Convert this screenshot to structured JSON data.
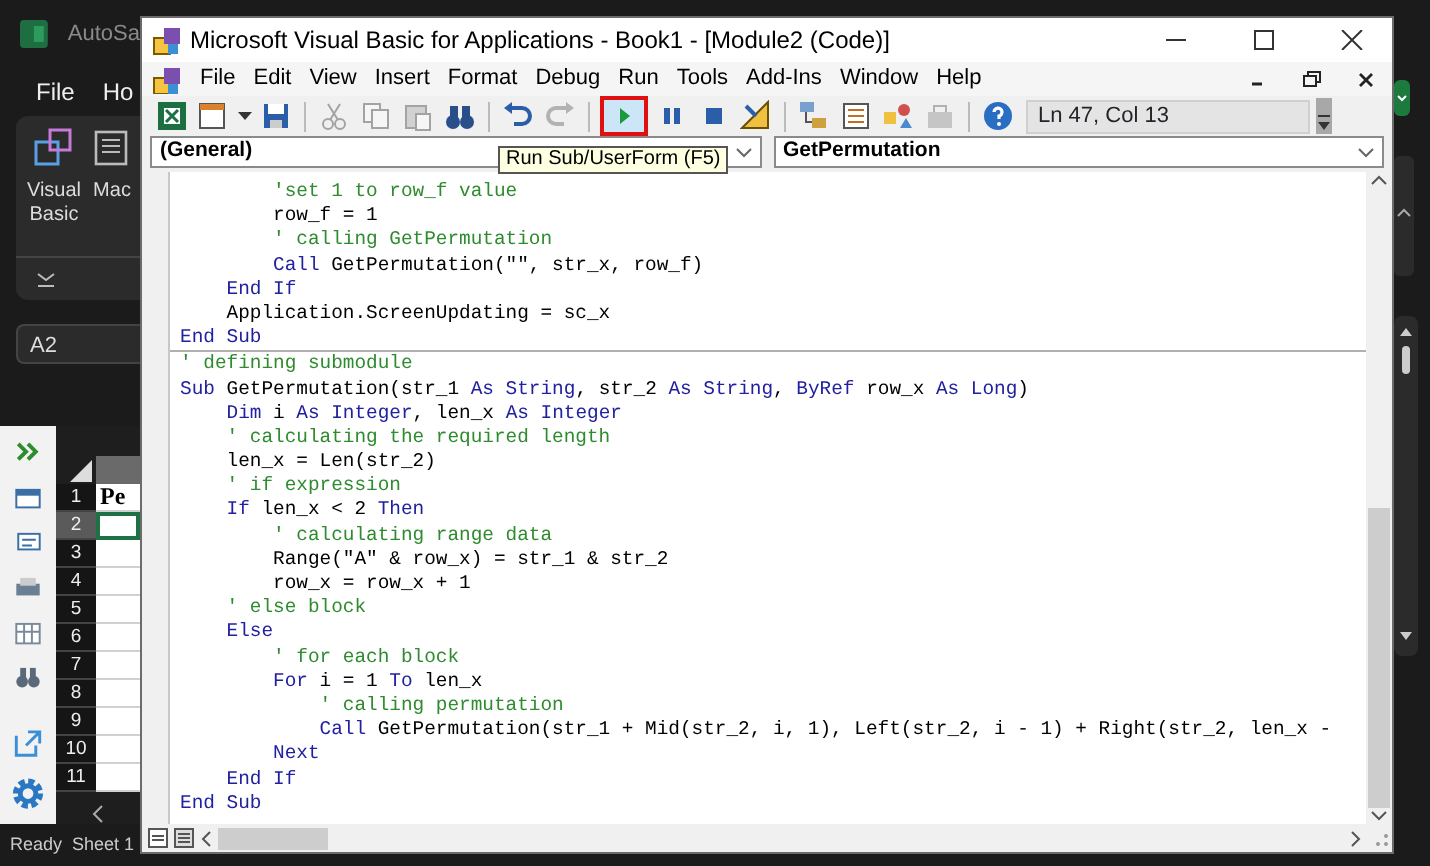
{
  "excel": {
    "app_title": "AutoSa",
    "ribbon_tabs": [
      "File",
      "Ho"
    ],
    "ribbon_buttons": [
      {
        "label": "Visual Basic",
        "kind": "vba"
      },
      {
        "label": "Mac",
        "kind": "macro"
      }
    ],
    "name_box": "A2",
    "rows": [
      {
        "number": "1",
        "cell": "Pe",
        "selected": false
      },
      {
        "number": "2",
        "selected": true
      },
      {
        "number": "3",
        "selected": false
      },
      {
        "number": "4",
        "selected": false
      },
      {
        "number": "5",
        "selected": false
      },
      {
        "number": "6",
        "selected": false
      },
      {
        "number": "7",
        "selected": false
      },
      {
        "number": "8",
        "selected": false
      },
      {
        "number": "9",
        "selected": false
      },
      {
        "number": "10",
        "selected": false
      },
      {
        "number": "11",
        "selected": false
      }
    ],
    "status": "Ready",
    "sheet_tab": "Sheet 1"
  },
  "vba": {
    "window": {
      "title": "Microsoft Visual Basic for Applications - Book1 - [Module2 (Code)]"
    },
    "menu": [
      "File",
      "Edit",
      "View",
      "Insert",
      "Format",
      "Debug",
      "Run",
      "Tools",
      "Add-Ins",
      "Window",
      "Help"
    ],
    "toolbar": {
      "items": [
        {
          "kind": "excel",
          "disabled": false,
          "highlighted": false
        },
        {
          "kind": "userform",
          "disabled": false,
          "highlighted": false
        },
        {
          "kind": "save",
          "disabled": false,
          "highlighted": false
        },
        {
          "kind": "separator"
        },
        {
          "kind": "cut",
          "disabled": true,
          "highlighted": false
        },
        {
          "kind": "copy",
          "disabled": true,
          "highlighted": false
        },
        {
          "kind": "paste",
          "disabled": true,
          "highlighted": false
        },
        {
          "kind": "find",
          "disabled": false,
          "highlighted": false
        },
        {
          "kind": "separator"
        },
        {
          "kind": "undo",
          "disabled": false,
          "highlighted": false
        },
        {
          "kind": "redo",
          "disabled": true,
          "highlighted": false
        },
        {
          "kind": "separator"
        },
        {
          "kind": "run",
          "disabled": false,
          "highlighted": true
        },
        {
          "kind": "break",
          "disabled": false,
          "highlighted": false
        },
        {
          "kind": "reset",
          "disabled": false,
          "highlighted": false
        },
        {
          "kind": "design",
          "disabled": false,
          "highlighted": false
        },
        {
          "kind": "separator"
        },
        {
          "kind": "project",
          "disabled": false,
          "highlighted": false
        },
        {
          "kind": "properties",
          "disabled": false,
          "highlighted": false
        },
        {
          "kind": "browser",
          "disabled": false,
          "highlighted": false
        },
        {
          "kind": "toolbox",
          "disabled": true,
          "highlighted": false
        },
        {
          "kind": "separator"
        },
        {
          "kind": "help",
          "disabled": false,
          "highlighted": false
        }
      ],
      "position": "Ln 47, Col 13",
      "tooltip": "Run Sub/UserForm (F5)"
    },
    "object_dropdown": "(General)",
    "procedure_dropdown": "GetPermutation",
    "procedures": [
      {
        "lines": [
          [
            {
              "kind": "comment",
              "text": "        'set 1 to row_f value"
            }
          ],
          [
            {
              "kind": "code",
              "text": "        row_f = 1"
            }
          ],
          [
            {
              "kind": "comment",
              "text": "        ' calling GetPermutation"
            }
          ],
          [
            {
              "kind": "keyword",
              "text": "        Call"
            },
            {
              "kind": "code",
              "text": " GetPermutation(\"\", str_x, row_f)"
            }
          ],
          [
            {
              "kind": "keyword",
              "text": "    End If"
            }
          ],
          [
            {
              "kind": "code",
              "text": "    Application.ScreenUpdating = sc_x"
            }
          ],
          [
            {
              "kind": "keyword",
              "text": "End Sub"
            }
          ]
        ]
      },
      {
        "lines": [
          [
            {
              "kind": "comment",
              "text": "' defining submodule"
            }
          ],
          [
            {
              "kind": "keyword",
              "text": "Sub"
            },
            {
              "kind": "code",
              "text": " GetPermutation(str_1 "
            },
            {
              "kind": "keyword",
              "text": "As String"
            },
            {
              "kind": "code",
              "text": ", str_2 "
            },
            {
              "kind": "keyword",
              "text": "As String"
            },
            {
              "kind": "code",
              "text": ", "
            },
            {
              "kind": "keyword",
              "text": "ByRef"
            },
            {
              "kind": "code",
              "text": " row_x "
            },
            {
              "kind": "keyword",
              "text": "As Long"
            },
            {
              "kind": "code",
              "text": ")"
            }
          ],
          [
            {
              "kind": "keyword",
              "text": "    Dim"
            },
            {
              "kind": "code",
              "text": " i "
            },
            {
              "kind": "keyword",
              "text": "As Integer"
            },
            {
              "kind": "code",
              "text": ", len_x "
            },
            {
              "kind": "keyword",
              "text": "As Integer"
            }
          ],
          [
            {
              "kind": "comment",
              "text": "    ' calculating the required length"
            }
          ],
          [
            {
              "kind": "code",
              "text": "    len_x = Len(str_2)"
            }
          ],
          [
            {
              "kind": "comment",
              "text": "    ' if expression"
            }
          ],
          [
            {
              "kind": "keyword",
              "text": "    If"
            },
            {
              "kind": "code",
              "text": " len_x < 2 "
            },
            {
              "kind": "keyword",
              "text": "Then"
            }
          ],
          [
            {
              "kind": "comment",
              "text": "        ' calculating range data"
            }
          ],
          [
            {
              "kind": "code",
              "text": "        Range(\"A\" & row_x) = str_1 & str_2"
            }
          ],
          [
            {
              "kind": "code",
              "text": "        row_x = row_x + 1"
            }
          ],
          [
            {
              "kind": "comment",
              "text": "    ' else block"
            }
          ],
          [
            {
              "kind": "keyword",
              "text": "    Else"
            }
          ],
          [
            {
              "kind": "comment",
              "text": "        ' for each block"
            }
          ],
          [
            {
              "kind": "keyword",
              "text": "        For"
            },
            {
              "kind": "code",
              "text": " i = 1 "
            },
            {
              "kind": "keyword",
              "text": "To"
            },
            {
              "kind": "code",
              "text": " len_x"
            }
          ],
          [
            {
              "kind": "comment",
              "text": "            ' calling permutation"
            }
          ],
          [
            {
              "kind": "keyword",
              "text": "            Call"
            },
            {
              "kind": "code",
              "text": " GetPermutation(str_1 + Mid(str_2, i, 1), Left(str_2, i - 1) + Right(str_2, len_x -"
            }
          ],
          [
            {
              "kind": "keyword",
              "text": "        Next"
            }
          ],
          [
            {
              "kind": "keyword",
              "text": "    End If"
            }
          ],
          [
            {
              "kind": "keyword",
              "text": "End Sub"
            }
          ]
        ]
      }
    ]
  }
}
